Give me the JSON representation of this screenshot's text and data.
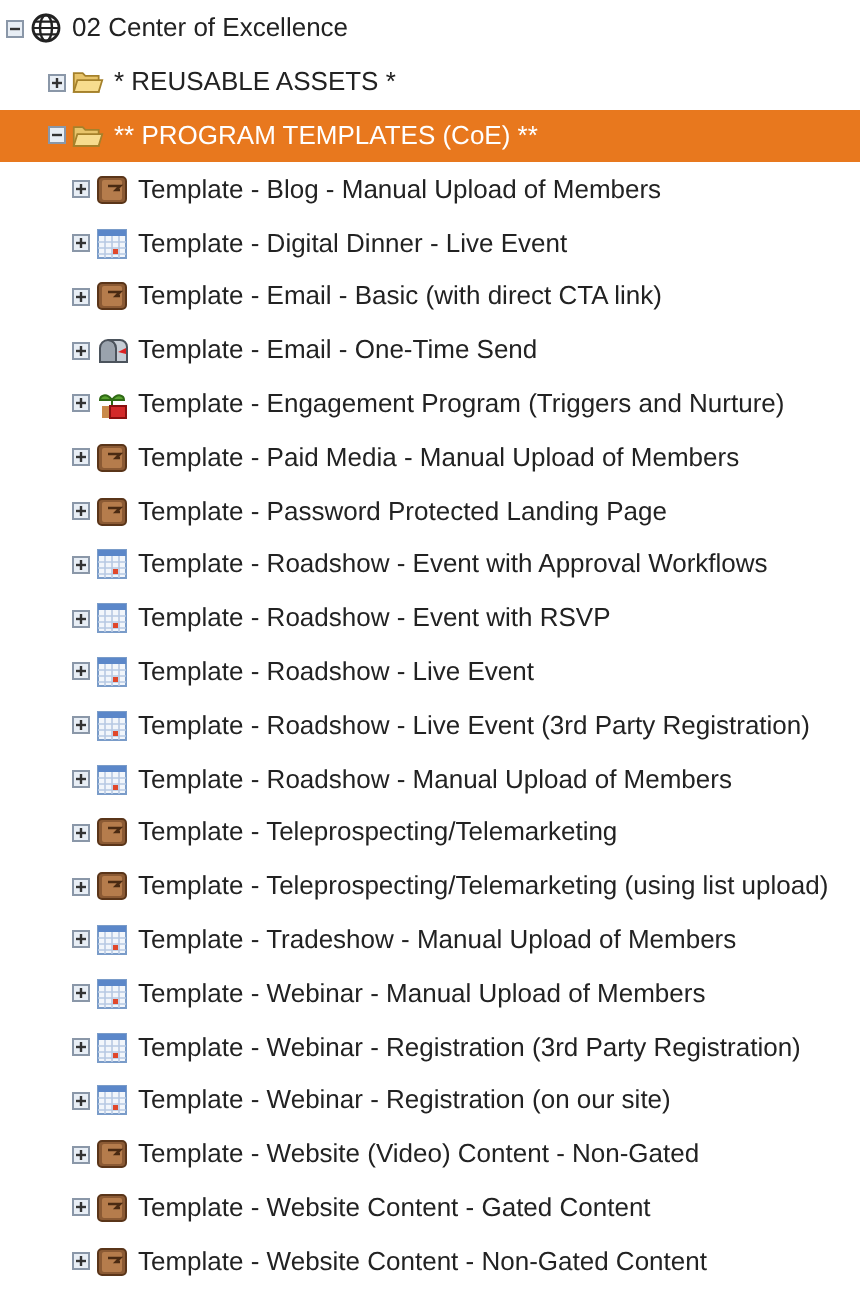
{
  "tree": [
    {
      "label": "02 Center of Excellence",
      "kind": "workspace",
      "expanded": true,
      "selected": false,
      "children": [
        {
          "label": "* REUSABLE ASSETS *",
          "kind": "folder",
          "expanded": false,
          "selected": false
        },
        {
          "label": "** PROGRAM TEMPLATES (CoE) **",
          "kind": "folder",
          "expanded": true,
          "selected": true,
          "children": [
            {
              "label": "Template - Blog - Manual Upload of Members",
              "kind": "program",
              "expanded": false,
              "selected": false
            },
            {
              "label": "Template - Digital Dinner - Live Event",
              "kind": "event",
              "expanded": false,
              "selected": false
            },
            {
              "label": "Template - Email - Basic (with direct CTA link)",
              "kind": "program",
              "expanded": false,
              "selected": false
            },
            {
              "label": "Template - Email - One-Time Send",
              "kind": "email",
              "expanded": false,
              "selected": false
            },
            {
              "label": "Template - Engagement Program (Triggers and Nurture)",
              "kind": "engagement",
              "expanded": false,
              "selected": false
            },
            {
              "label": "Template - Paid Media - Manual Upload of Members",
              "kind": "program",
              "expanded": false,
              "selected": false
            },
            {
              "label": "Template - Password Protected Landing Page",
              "kind": "program",
              "expanded": false,
              "selected": false
            },
            {
              "label": "Template - Roadshow - Event with Approval Workflows",
              "kind": "event",
              "expanded": false,
              "selected": false
            },
            {
              "label": "Template - Roadshow - Event with RSVP",
              "kind": "event",
              "expanded": false,
              "selected": false
            },
            {
              "label": "Template - Roadshow - Live Event",
              "kind": "event",
              "expanded": false,
              "selected": false
            },
            {
              "label": "Template - Roadshow - Live Event (3rd Party Registration)",
              "kind": "event",
              "expanded": false,
              "selected": false
            },
            {
              "label": "Template - Roadshow - Manual Upload of Members",
              "kind": "event",
              "expanded": false,
              "selected": false
            },
            {
              "label": "Template - Teleprospecting/Telemarketing",
              "kind": "program",
              "expanded": false,
              "selected": false
            },
            {
              "label": "Template - Teleprospecting/Telemarketing (using list upload)",
              "kind": "program",
              "expanded": false,
              "selected": false
            },
            {
              "label": "Template - Tradeshow - Manual Upload of Members",
              "kind": "event",
              "expanded": false,
              "selected": false
            },
            {
              "label": "Template - Webinar - Manual Upload of Members",
              "kind": "event",
              "expanded": false,
              "selected": false
            },
            {
              "label": "Template - Webinar - Registration (3rd Party Registration)",
              "kind": "event",
              "expanded": false,
              "selected": false
            },
            {
              "label": "Template - Webinar - Registration (on our site)",
              "kind": "event",
              "expanded": false,
              "selected": false
            },
            {
              "label": "Template - Website (Video) Content - Non-Gated",
              "kind": "program",
              "expanded": false,
              "selected": false
            },
            {
              "label": "Template - Website Content - Gated Content",
              "kind": "program",
              "expanded": false,
              "selected": false
            },
            {
              "label": "Template - Website Content - Non-Gated Content",
              "kind": "program",
              "expanded": false,
              "selected": false
            }
          ]
        }
      ]
    }
  ]
}
